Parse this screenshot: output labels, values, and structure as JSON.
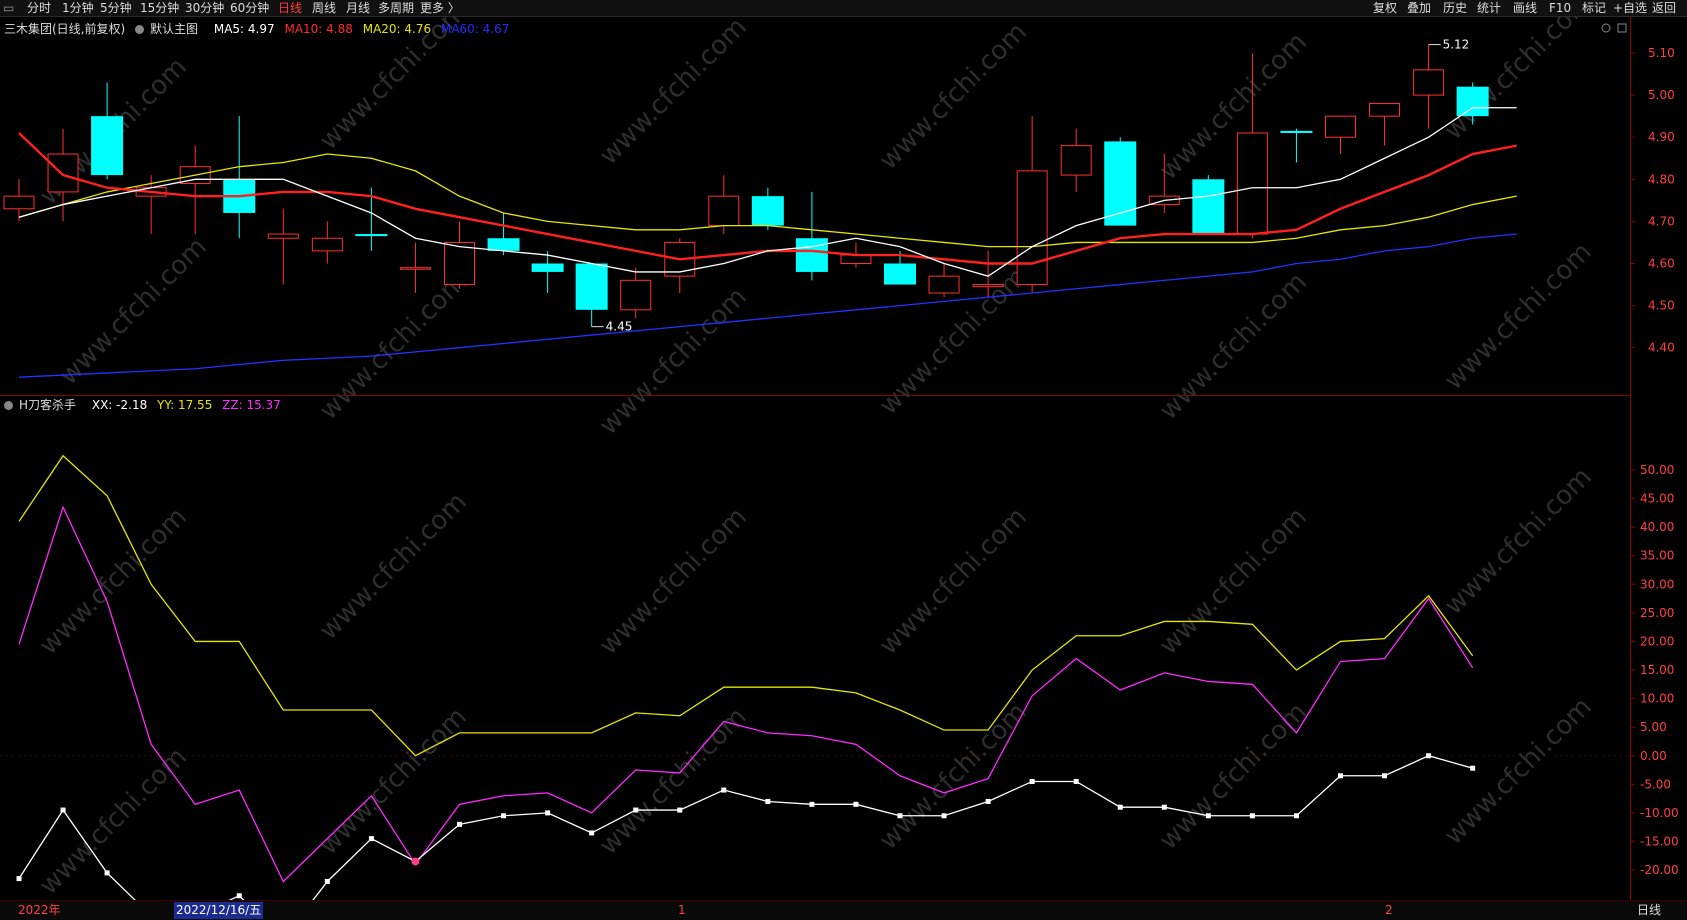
{
  "toolbar": {
    "left_items": [
      "分时",
      "1分钟",
      "5分钟",
      "15分钟",
      "30分钟",
      "60分钟",
      "日线",
      "周线",
      "月线",
      "多周期",
      "更多 〉"
    ],
    "active_item": "日线",
    "right_items": [
      "复权",
      "叠加",
      "历史",
      "统计",
      "画线",
      "F10",
      "标记",
      "+自选",
      "返回"
    ]
  },
  "main_chart": {
    "stock": "三木集团(日线,前复权)",
    "template": "默认主图",
    "indicators": [
      {
        "label": "MA5: 4.97",
        "color": "#ffffff"
      },
      {
        "label": "MA10: 4.88",
        "color": "#ff2a2a"
      },
      {
        "label": "MA20: 4.76",
        "color": "#e6e600"
      },
      {
        "label": "MA60: 4.67",
        "color": "#2a2aff"
      }
    ],
    "high_marker": "5.12",
    "low_marker": "4.45",
    "y_ticks": [
      "5.10",
      "5.00",
      "4.90",
      "4.80",
      "4.70",
      "4.60",
      "4.50",
      "4.40"
    ]
  },
  "sub_chart": {
    "name": "H刀客杀手",
    "values": [
      {
        "label": "XX: -2.18",
        "color": "#ffffff"
      },
      {
        "label": "YY: 17.55",
        "color": "#e6e600"
      },
      {
        "label": "ZZ: 15.37",
        "color": "#ff2aff"
      }
    ],
    "y_ticks": [
      "50.00",
      "45.00",
      "40.00",
      "35.00",
      "30.00",
      "25.00",
      "20.00",
      "15.00",
      "10.00",
      "5.00",
      "0.00",
      "-5.00",
      "-10.00",
      "-15.00",
      "-20.00"
    ]
  },
  "bottom_bar": {
    "year_label": "2022年",
    "selected_date": "2022/12/16/五",
    "month_marks": [
      "1",
      "2"
    ],
    "period": "日线"
  },
  "watermark": "www.cfchi.com",
  "chart_data": [
    {
      "type": "candlestick",
      "title": "三木集团(日线,前复权)",
      "ylim": [
        4.32,
        5.14
      ],
      "candles": [
        {
          "o": 4.73,
          "h": 4.8,
          "l": 4.7,
          "c": 4.76
        },
        {
          "o": 4.77,
          "h": 4.92,
          "l": 4.7,
          "c": 4.86
        },
        {
          "o": 4.95,
          "h": 5.03,
          "l": 4.8,
          "c": 4.81
        },
        {
          "o": 4.76,
          "h": 4.81,
          "l": 4.67,
          "c": 4.78
        },
        {
          "o": 4.79,
          "h": 4.88,
          "l": 4.67,
          "c": 4.83
        },
        {
          "o": 4.8,
          "h": 4.95,
          "l": 4.66,
          "c": 4.72
        },
        {
          "o": 4.66,
          "h": 4.73,
          "l": 4.55,
          "c": 4.67
        },
        {
          "o": 4.63,
          "h": 4.7,
          "l": 4.6,
          "c": 4.66
        },
        {
          "o": 4.67,
          "h": 4.78,
          "l": 4.63,
          "c": 4.665
        },
        {
          "o": 4.59,
          "h": 4.65,
          "l": 4.53,
          "c": 4.59
        },
        {
          "o": 4.55,
          "h": 4.7,
          "l": 4.54,
          "c": 4.65
        },
        {
          "o": 4.66,
          "h": 4.72,
          "l": 4.62,
          "c": 4.63
        },
        {
          "o": 4.6,
          "h": 4.63,
          "l": 4.53,
          "c": 4.58
        },
        {
          "o": 4.6,
          "h": 4.6,
          "l": 4.45,
          "c": 4.49
        },
        {
          "o": 4.49,
          "h": 4.59,
          "l": 4.47,
          "c": 4.56
        },
        {
          "o": 4.57,
          "h": 4.66,
          "l": 4.53,
          "c": 4.65
        },
        {
          "o": 4.69,
          "h": 4.81,
          "l": 4.67,
          "c": 4.76
        },
        {
          "o": 4.76,
          "h": 4.78,
          "l": 4.68,
          "c": 4.69
        },
        {
          "o": 4.66,
          "h": 4.77,
          "l": 4.56,
          "c": 4.58
        },
        {
          "o": 4.6,
          "h": 4.65,
          "l": 4.59,
          "c": 4.62
        },
        {
          "o": 4.6,
          "h": 4.63,
          "l": 4.55,
          "c": 4.55
        },
        {
          "o": 4.53,
          "h": 4.6,
          "l": 4.52,
          "c": 4.57
        },
        {
          "o": 4.545,
          "h": 4.63,
          "l": 4.52,
          "c": 4.55
        },
        {
          "o": 4.55,
          "h": 4.95,
          "l": 4.53,
          "c": 4.82
        },
        {
          "o": 4.81,
          "h": 4.92,
          "l": 4.77,
          "c": 4.88
        },
        {
          "o": 4.89,
          "h": 4.9,
          "l": 4.69,
          "c": 4.69
        },
        {
          "o": 4.74,
          "h": 4.86,
          "l": 4.72,
          "c": 4.76
        },
        {
          "o": 4.8,
          "h": 4.81,
          "l": 4.67,
          "c": 4.67
        },
        {
          "o": 4.67,
          "h": 5.1,
          "l": 4.66,
          "c": 4.91
        },
        {
          "o": 4.915,
          "h": 4.92,
          "l": 4.84,
          "c": 4.91
        },
        {
          "o": 4.9,
          "h": 4.95,
          "l": 4.86,
          "c": 4.95
        },
        {
          "o": 4.95,
          "h": 4.98,
          "l": 4.88,
          "c": 4.98
        },
        {
          "o": 5.0,
          "h": 5.12,
          "l": 4.92,
          "c": 5.06
        },
        {
          "o": 5.02,
          "h": 5.03,
          "l": 4.93,
          "c": 4.95
        }
      ],
      "ma5": [
        4.71,
        4.74,
        4.76,
        4.78,
        4.8,
        4.8,
        4.8,
        4.76,
        4.72,
        4.66,
        4.64,
        4.63,
        4.62,
        4.6,
        4.58,
        4.58,
        4.6,
        4.63,
        4.64,
        4.66,
        4.64,
        4.6,
        4.57,
        4.64,
        4.69,
        4.72,
        4.75,
        4.76,
        4.78,
        4.78,
        4.8,
        4.85,
        4.9,
        4.97,
        4.97
      ],
      "ma10": [
        4.91,
        4.81,
        4.78,
        4.77,
        4.76,
        4.76,
        4.77,
        4.77,
        4.76,
        4.73,
        4.71,
        4.69,
        4.67,
        4.65,
        4.63,
        4.61,
        4.62,
        4.63,
        4.63,
        4.62,
        4.62,
        4.61,
        4.6,
        4.6,
        4.63,
        4.66,
        4.67,
        4.67,
        4.67,
        4.68,
        4.73,
        4.77,
        4.81,
        4.86,
        4.88
      ],
      "ma20": [
        4.71,
        4.74,
        4.77,
        4.79,
        4.81,
        4.83,
        4.84,
        4.86,
        4.85,
        4.82,
        4.76,
        4.72,
        4.7,
        4.69,
        4.68,
        4.68,
        4.69,
        4.69,
        4.68,
        4.67,
        4.66,
        4.65,
        4.64,
        4.64,
        4.65,
        4.65,
        4.65,
        4.65,
        4.65,
        4.66,
        4.68,
        4.69,
        4.71,
        4.74,
        4.76
      ],
      "ma60": [
        4.33,
        4.335,
        4.34,
        4.345,
        4.35,
        4.36,
        4.37,
        4.375,
        4.38,
        4.39,
        4.4,
        4.41,
        4.42,
        4.43,
        4.44,
        4.45,
        4.46,
        4.47,
        4.48,
        4.49,
        4.5,
        4.51,
        4.52,
        4.53,
        4.54,
        4.55,
        4.56,
        4.57,
        4.58,
        4.6,
        4.61,
        4.63,
        4.64,
        4.66,
        4.67
      ]
    },
    {
      "type": "line",
      "title": "H刀客杀手",
      "ylim": [
        -25,
        56
      ],
      "series": [
        {
          "name": "YY",
          "color": "#e6e600",
          "values": [
            41,
            52.5,
            45.5,
            30,
            20,
            20,
            8,
            8,
            8,
            0,
            4,
            4,
            4,
            4,
            7.5,
            7,
            12,
            12,
            12,
            11,
            8,
            4.5,
            4.5,
            15,
            21,
            21,
            23.5,
            23.5,
            23,
            15,
            20,
            20.5,
            28,
            17.5
          ]
        },
        {
          "name": "ZZ",
          "color": "#ff2aff",
          "values": [
            19.5,
            43.5,
            27,
            2,
            -8.5,
            -6,
            -22,
            -14.5,
            -7,
            -19,
            -8.5,
            -7,
            -6.5,
            -10,
            -2.5,
            -3,
            6,
            4,
            3.5,
            2,
            -3.5,
            -6.5,
            -4,
            10.5,
            17,
            11.5,
            14.5,
            13,
            12.5,
            4,
            16.5,
            17,
            27.5,
            15.4
          ]
        },
        {
          "name": "XX",
          "color": "#ffffff",
          "values": [
            -21.5,
            -9.5,
            -20.5,
            -28,
            -28,
            -24.5,
            -32,
            -22,
            -14.5,
            -18.5,
            -12,
            -10.5,
            -10,
            -13.5,
            -9.5,
            -9.5,
            -6,
            -8,
            -8.5,
            -8.5,
            -10.5,
            -10.5,
            -8,
            -4.5,
            -4.5,
            -9,
            -9,
            -10.5,
            -10.5,
            -10.5,
            -3.5,
            -3.5,
            0,
            -2.18
          ]
        }
      ]
    }
  ]
}
